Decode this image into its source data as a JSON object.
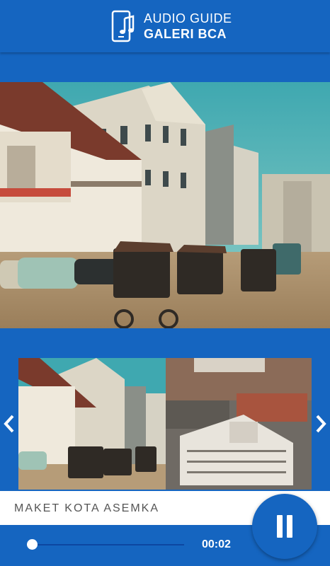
{
  "header": {
    "title_line1": "AUDIO GUIDE",
    "title_line2": "GALERI BCA",
    "logo_icon": "phone-music-icon"
  },
  "hero": {
    "image": "old-street-photo"
  },
  "carousel": {
    "thumbnails": [
      {
        "image": "old-street-thumbnail"
      },
      {
        "image": "aerial-city-thumbnail"
      }
    ],
    "prev_icon": "chevron-left-icon",
    "next_icon": "chevron-right-icon"
  },
  "track": {
    "title": "MAKET KOTA ASEMKA"
  },
  "player": {
    "elapsed": "00:02",
    "progress": 0.0,
    "state_icon": "pause-icon"
  },
  "colors": {
    "primary": "#1565c0",
    "dark": "#0d47a1",
    "white": "#ffffff"
  }
}
